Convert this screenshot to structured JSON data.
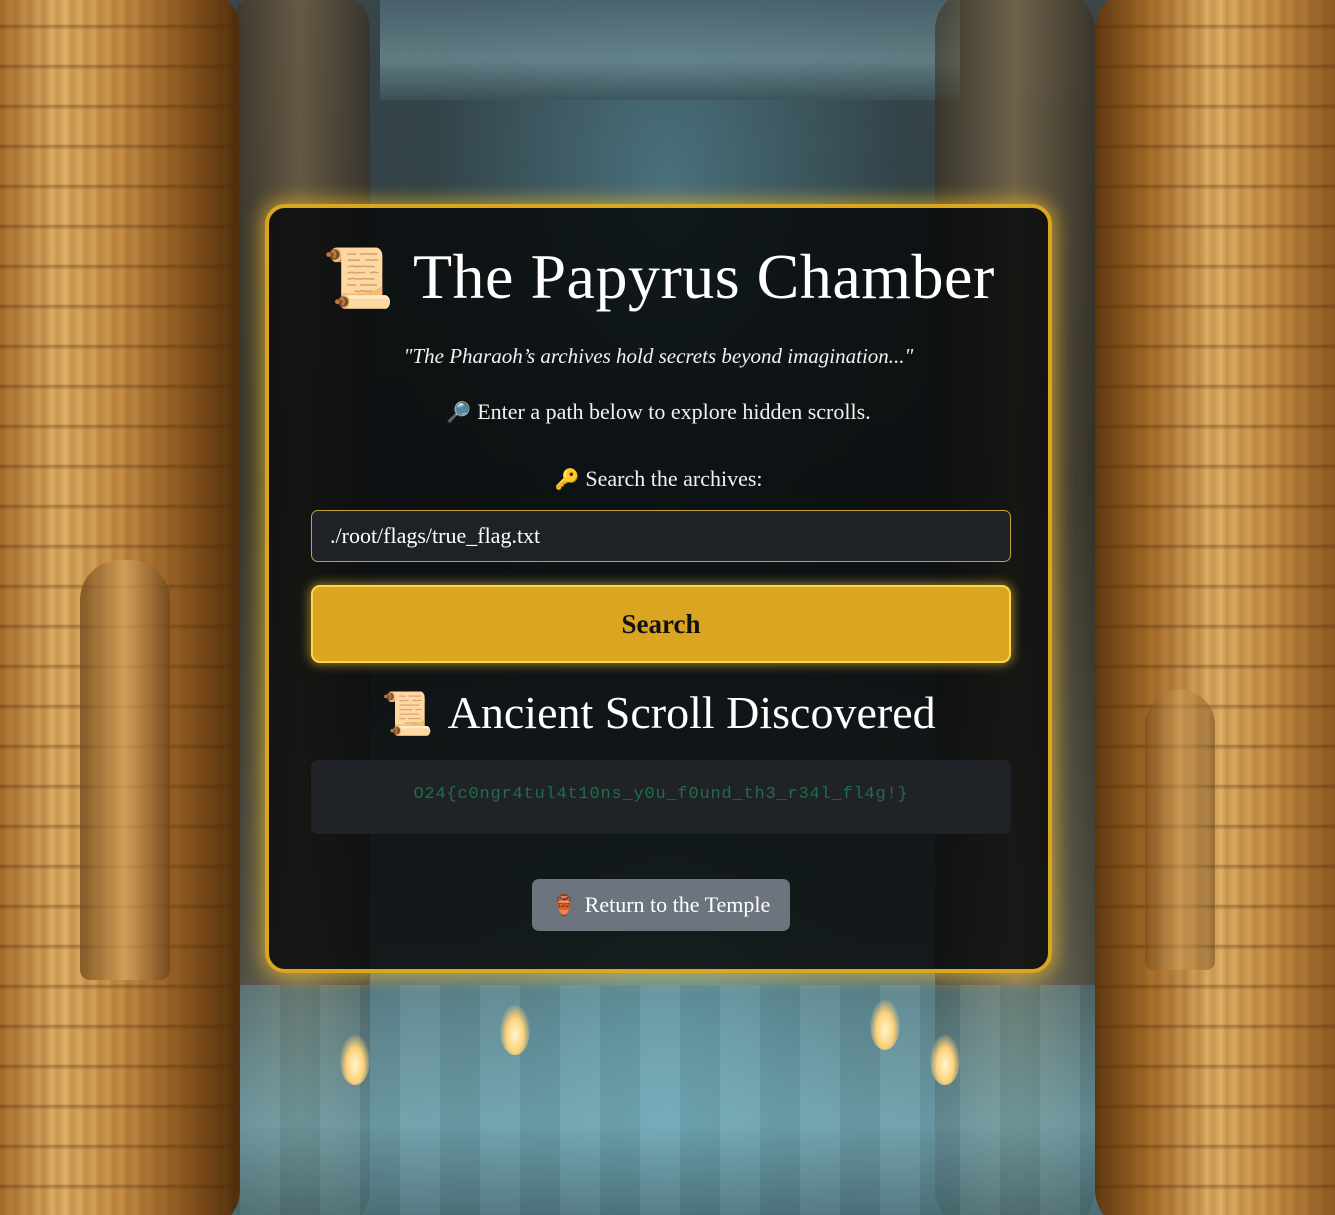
{
  "page": {
    "title": "The Papyrus Chamber",
    "title_icon": "📜",
    "quote": "\"The Pharaoh’s archives hold secrets beyond imagination...\"",
    "hint_icon": "🔎",
    "hint": "Enter a path below to explore hidden scrolls."
  },
  "search": {
    "label_icon": "🔑",
    "label": "Search the archives:",
    "value": "./root/flags/true_flag.txt",
    "button_label": "Search"
  },
  "result": {
    "title_icon": "📜",
    "title": "Ancient Scroll Discovered",
    "content": "O24{c0ngr4tul4t10ns_y0u_f0und_th3_r34l_fl4g!}"
  },
  "nav": {
    "return_icon": "🏺",
    "return_label": "Return to the Temple"
  },
  "colors": {
    "accent_gold": "#daa520",
    "panel_border": "#d9a71f",
    "flag_text": "#1f6e45",
    "return_button": "#6c757d"
  }
}
